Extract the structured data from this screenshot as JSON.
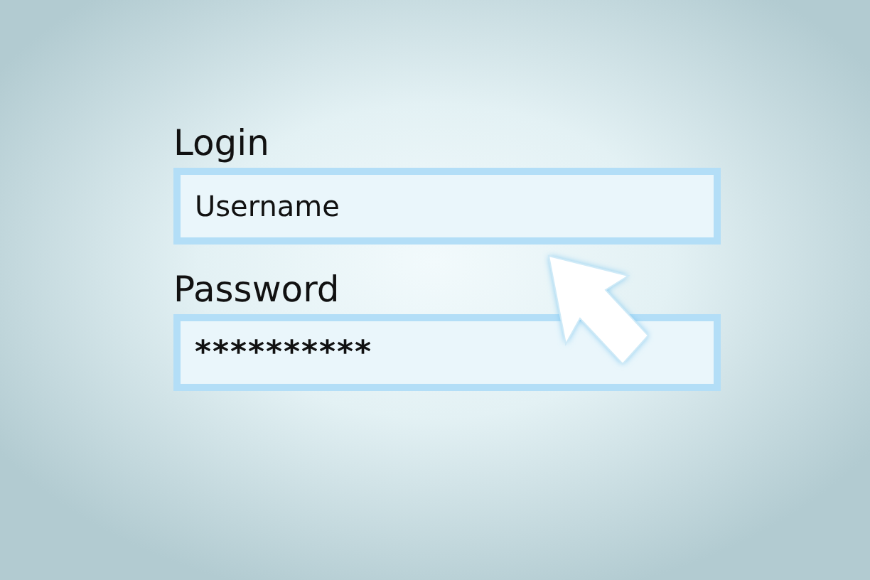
{
  "title": "Login",
  "fields": [
    {
      "value": "Username",
      "kind": "text"
    },
    {
      "label": "Password",
      "value": "**********",
      "kind": "password"
    }
  ]
}
